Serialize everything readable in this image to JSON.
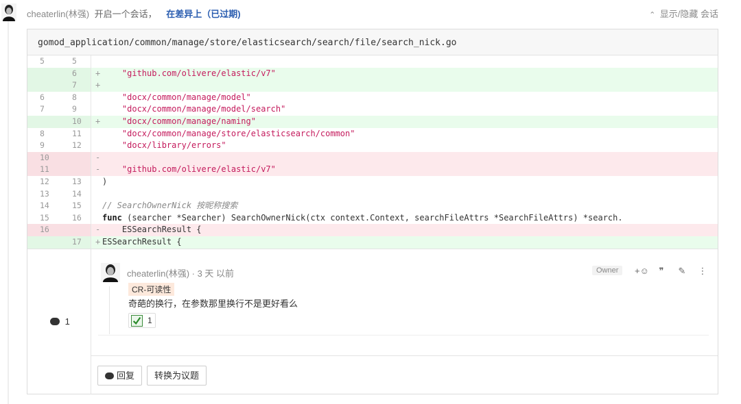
{
  "event": {
    "author": "cheaterlin(林强)",
    "action": "开启一个会话，",
    "place": "在差异上（已过期)",
    "toggle_label": "显示/隐藏 会话"
  },
  "file": {
    "path": "gomod_application/common/manage/store/elasticsearch/search/file/search_nick.go"
  },
  "diff": {
    "rows": [
      {
        "type": "ctx",
        "old": "5",
        "new": "5",
        "mark": "",
        "code": ""
      },
      {
        "type": "add",
        "old": "",
        "new": "6",
        "mark": "+",
        "code": "    \"github.com/olivere/elastic/v7\""
      },
      {
        "type": "add",
        "old": "",
        "new": "7",
        "mark": "+",
        "code": ""
      },
      {
        "type": "ctx",
        "old": "6",
        "new": "8",
        "mark": "",
        "code": "    \"docx/common/manage/model\""
      },
      {
        "type": "ctx",
        "old": "7",
        "new": "9",
        "mark": "",
        "code": "    \"docx/common/manage/model/search\""
      },
      {
        "type": "add",
        "old": "",
        "new": "10",
        "mark": "+",
        "code": "    \"docx/common/manage/naming\""
      },
      {
        "type": "ctx",
        "old": "8",
        "new": "11",
        "mark": "",
        "code": "    \"docx/common/manage/store/elasticsearch/common\""
      },
      {
        "type": "ctx",
        "old": "9",
        "new": "12",
        "mark": "",
        "code": "    \"docx/library/errors\""
      },
      {
        "type": "del",
        "old": "10",
        "new": "",
        "mark": "-",
        "code": ""
      },
      {
        "type": "del",
        "old": "11",
        "new": "",
        "mark": "-",
        "code": "    \"github.com/olivere/elastic/v7\""
      },
      {
        "type": "ctx",
        "old": "12",
        "new": "13",
        "mark": "",
        "code": ")"
      },
      {
        "type": "ctx",
        "old": "13",
        "new": "14",
        "mark": "",
        "code": ""
      },
      {
        "type": "ctx",
        "old": "14",
        "new": "15",
        "mark": "",
        "code": "// SearchOwnerNick 按昵称搜索"
      },
      {
        "type": "ctx",
        "old": "15",
        "new": "16",
        "mark": "",
        "code": "func (searcher *Searcher) SearchOwnerNick(ctx context.Context, searchFileAttrs *SearchFileAttrs) *search."
      },
      {
        "type": "del",
        "old": "16",
        "new": "",
        "mark": "-",
        "code": "    ESSearchResult {"
      },
      {
        "type": "add",
        "old": "",
        "new": "17",
        "mark": "+",
        "code": "ESSearchResult {"
      }
    ]
  },
  "comment_count": "1",
  "comment": {
    "author": "cheaterlin(林强)",
    "time": " · 3 天 以前",
    "tag": "CR-可读性",
    "body": "奇葩的换行，在参数那里换行不是更好看么",
    "reaction_count": "1",
    "owner_badge": "Owner",
    "actions": [
      "+☺",
      "❞",
      "✎",
      "⋮"
    ]
  },
  "buttons": {
    "reply": "回复",
    "convert": "转换为议题"
  },
  "icons": {
    "avatar": "avatar-icon",
    "chevron": "chevron-up-icon",
    "comment": "comment-bubble-icon",
    "check": "check-box-icon"
  }
}
